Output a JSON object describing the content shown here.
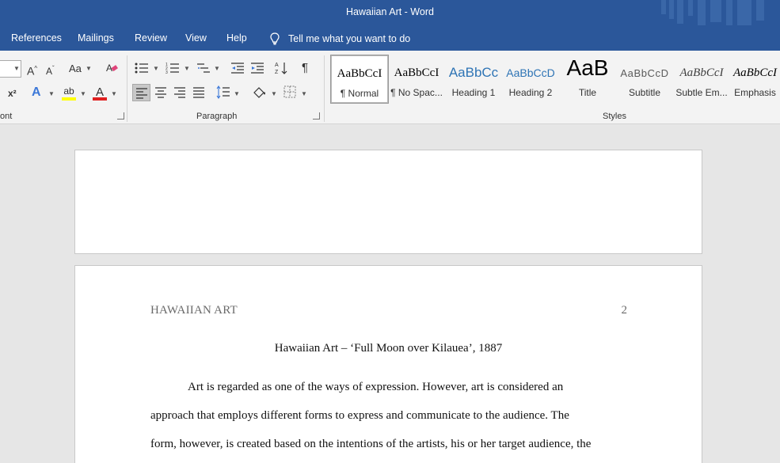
{
  "titlebar": {
    "title": "Hawaiian Art  -  Word"
  },
  "tabs": [
    {
      "label": "References"
    },
    {
      "label": "Mailings"
    },
    {
      "label": "Review"
    },
    {
      "label": "View"
    },
    {
      "label": "Help"
    }
  ],
  "tell_me": {
    "label": "Tell me what you want to do"
  },
  "groups": {
    "font": "ont",
    "paragraph": "Paragraph",
    "styles": "Styles"
  },
  "styles": [
    {
      "sample": "AaBbCcI",
      "name": "¶ Normal"
    },
    {
      "sample": "AaBbCcI",
      "name": "¶ No Spac..."
    },
    {
      "sample": "AaBbCc",
      "name": "Heading 1"
    },
    {
      "sample": "AaBbCcD",
      "name": "Heading 2"
    },
    {
      "sample": "AaB",
      "name": "Title"
    },
    {
      "sample": "AaBbCcD",
      "name": "Subtitle"
    },
    {
      "sample": "AaBbCcI",
      "name": "Subtle Em..."
    },
    {
      "sample": "AaBbCcI",
      "name": "Emphasis"
    }
  ],
  "document": {
    "header_text": "HAWAIIAN ART",
    "page_number": "2",
    "title": "Hawaiian Art – ‘Full Moon over Kilauea’, 1887",
    "lines": [
      "Art is regarded as one of the ways of expression. However, art is considered an",
      "approach that employs different forms to express and communicate to the audience. The",
      "form, however, is created based on the intentions of the artists, his or her target audience, the"
    ]
  },
  "colors": {
    "accent": "#2b579a",
    "ribbon": "#f3f3f3",
    "canvas": "#e6e6e6"
  }
}
